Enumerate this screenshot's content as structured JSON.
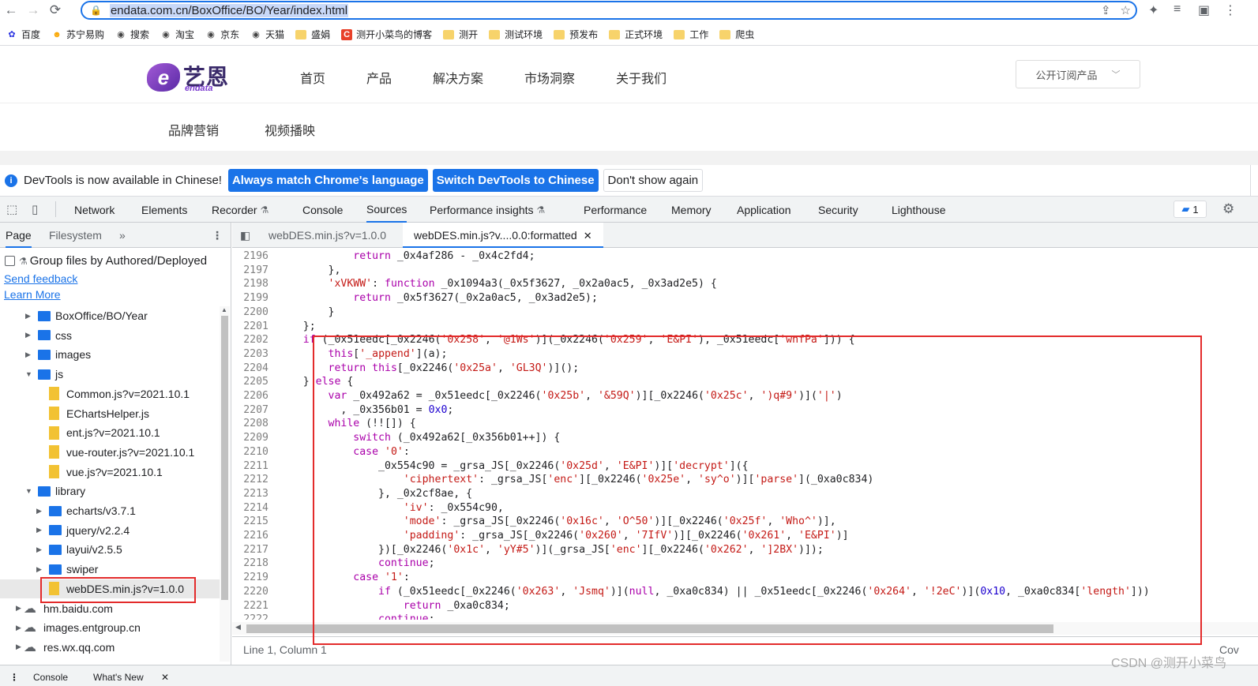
{
  "browser": {
    "url": "endata.com.cn/BoxOffice/BO/Year/index.html",
    "bookmarks": [
      {
        "label": "百度",
        "icon": "baidu-icon"
      },
      {
        "label": "苏宁易购",
        "icon": "suning-icon"
      },
      {
        "label": "搜索",
        "icon": "globe-icon"
      },
      {
        "label": "淘宝",
        "icon": "globe-icon"
      },
      {
        "label": "京东",
        "icon": "globe-icon"
      },
      {
        "label": "天猫",
        "icon": "globe-icon"
      },
      {
        "label": "盛娟",
        "icon": "folder-icon"
      },
      {
        "label": "测开小菜鸟的博客",
        "icon": "csdn-icon"
      },
      {
        "label": "测开",
        "icon": "folder-icon"
      },
      {
        "label": "测试环境",
        "icon": "folder-icon"
      },
      {
        "label": "预发布",
        "icon": "folder-icon"
      },
      {
        "label": "正式环境",
        "icon": "folder-icon"
      },
      {
        "label": "工作",
        "icon": "folder-icon"
      },
      {
        "label": "爬虫",
        "icon": "folder-icon"
      }
    ]
  },
  "site": {
    "logo_cn": "艺恩",
    "logo_en": "endata",
    "nav": [
      "首页",
      "产品",
      "解决方案",
      "市场洞察",
      "关于我们"
    ],
    "subscribe": "公开订阅产品",
    "subnav": [
      "品牌营销",
      "视频播映"
    ]
  },
  "infobar": {
    "message": "DevTools is now available in Chinese!",
    "btn_match": "Always match Chrome's language",
    "btn_switch": "Switch DevTools to Chinese",
    "btn_dismiss": "Don't show again"
  },
  "devtools": {
    "tabs": [
      "Network",
      "Elements",
      "Recorder",
      "Console",
      "Sources",
      "Performance insights",
      "Performance",
      "Memory",
      "Application",
      "Security",
      "Lighthouse"
    ],
    "active_tab": "Sources",
    "message_count": "1"
  },
  "navigator": {
    "tab_page": "Page",
    "tab_filesystem": "Filesystem",
    "more": "»",
    "group_label": "Group files by Authored/Deployed",
    "send_feedback": "Send feedback",
    "learn_more": "Learn More",
    "tree": [
      {
        "label": "BoxOffice/BO/Year",
        "type": "folder",
        "depth": 1,
        "state": "collapsed"
      },
      {
        "label": "css",
        "type": "folder",
        "depth": 1,
        "state": "collapsed"
      },
      {
        "label": "images",
        "type": "folder",
        "depth": 1,
        "state": "collapsed"
      },
      {
        "label": "js",
        "type": "folder",
        "depth": 1,
        "state": "expanded"
      },
      {
        "label": "Common.js?v=2021.10.1",
        "type": "file",
        "depth": 2
      },
      {
        "label": "EChartsHelper.js",
        "type": "file",
        "depth": 2
      },
      {
        "label": "ent.js?v=2021.10.1",
        "type": "file",
        "depth": 2
      },
      {
        "label": "vue-router.js?v=2021.10.1",
        "type": "file",
        "depth": 2
      },
      {
        "label": "vue.js?v=2021.10.1",
        "type": "file",
        "depth": 2
      },
      {
        "label": "library",
        "type": "folder",
        "depth": 1,
        "state": "expanded"
      },
      {
        "label": "echarts/v3.7.1",
        "type": "folder",
        "depth": 2,
        "state": "collapsed"
      },
      {
        "label": "jquery/v2.2.4",
        "type": "folder",
        "depth": 2,
        "state": "collapsed"
      },
      {
        "label": "layui/v2.5.5",
        "type": "folder",
        "depth": 2,
        "state": "collapsed"
      },
      {
        "label": "swiper",
        "type": "folder",
        "depth": 2,
        "state": "collapsed"
      },
      {
        "label": "webDES.min.js?v=1.0.0",
        "type": "file",
        "depth": 2,
        "selected": true
      },
      {
        "label": "hm.baidu.com",
        "type": "cloud",
        "depth": 0
      },
      {
        "label": "images.entgroup.cn",
        "type": "cloud",
        "depth": 0
      },
      {
        "label": "res.wx.qq.com",
        "type": "cloud",
        "depth": 0
      }
    ]
  },
  "editor": {
    "tab1": "webDES.min.js?v=1.0.0",
    "tab2": "webDES.min.js?v....0.0:formatted",
    "status": "Line 1, Column 1",
    "status_right": "Cov",
    "lines": [
      {
        "n": "2196",
        "code": "            return _0x4af286 - _0x4c2fd4;"
      },
      {
        "n": "2197",
        "code": "        },"
      },
      {
        "n": "2198",
        "code": "        'xVKWW': function _0x1094a3(_0x5f3627, _0x2a0ac5, _0x3ad2e5) {"
      },
      {
        "n": "2199",
        "code": "            return _0x5f3627(_0x2a0ac5, _0x3ad2e5);"
      },
      {
        "n": "2200",
        "code": "        }"
      },
      {
        "n": "2201",
        "code": "    };"
      },
      {
        "n": "2202",
        "code": "    if (_0x51eedc[_0x2246('0x258', '@1Ws')](_0x2246('0x259', 'E&PI'), _0x51eedc['wnfPa'])) {"
      },
      {
        "n": "2203",
        "code": "        this['_append'](a);"
      },
      {
        "n": "2204",
        "code": "        return this[_0x2246('0x25a', 'GL3Q')]();"
      },
      {
        "n": "2205",
        "code": "    } else {"
      },
      {
        "n": "2206",
        "code": "        var _0x492a62 = _0x51eedc[_0x2246('0x25b', '&59Q')][_0x2246('0x25c', ')q#9')]('|')"
      },
      {
        "n": "2207",
        "code": "          , _0x356b01 = 0x0;"
      },
      {
        "n": "2208",
        "code": "        while (!![]) {"
      },
      {
        "n": "2209",
        "code": "            switch (_0x492a62[_0x356b01++]) {"
      },
      {
        "n": "2210",
        "code": "            case '0':"
      },
      {
        "n": "2211",
        "code": "                _0x554c90 = _grsa_JS[_0x2246('0x25d', 'E&PI')]['decrypt']({"
      },
      {
        "n": "2212",
        "code": "                    'ciphertext': _grsa_JS['enc'][_0x2246('0x25e', 'sy^o')]['parse'](_0xa0c834)"
      },
      {
        "n": "2213",
        "code": "                }, _0x2cf8ae, {"
      },
      {
        "n": "2214",
        "code": "                    'iv': _0x554c90,"
      },
      {
        "n": "2215",
        "code": "                    'mode': _grsa_JS[_0x2246('0x16c', 'O^50')][_0x2246('0x25f', 'Who^')],"
      },
      {
        "n": "2216",
        "code": "                    'padding': _grsa_JS[_0x2246('0x260', '7IfV')][_0x2246('0x261', 'E&PI')]"
      },
      {
        "n": "2217",
        "code": "                })[_0x2246('0x1c', 'yY#5')](_grsa_JS['enc'][_0x2246('0x262', ']2BX')]);"
      },
      {
        "n": "2218",
        "code": "                continue;"
      },
      {
        "n": "2219",
        "code": "            case '1':"
      },
      {
        "n": "2220",
        "code": "                if (_0x51eedc[_0x2246('0x263', 'Jsmq')](null, _0xa0c834) || _0x51eedc[_0x2246('0x264', '!2eC')](0x10, _0xa0c834['length']))"
      },
      {
        "n": "2221",
        "code": "                    return _0xa0c834;"
      },
      {
        "n": "2222",
        "code": "                continue;"
      }
    ]
  },
  "drawer": {
    "console": "Console",
    "whats_new": "What's New"
  },
  "watermark": "CSDN @测开小菜鸟"
}
